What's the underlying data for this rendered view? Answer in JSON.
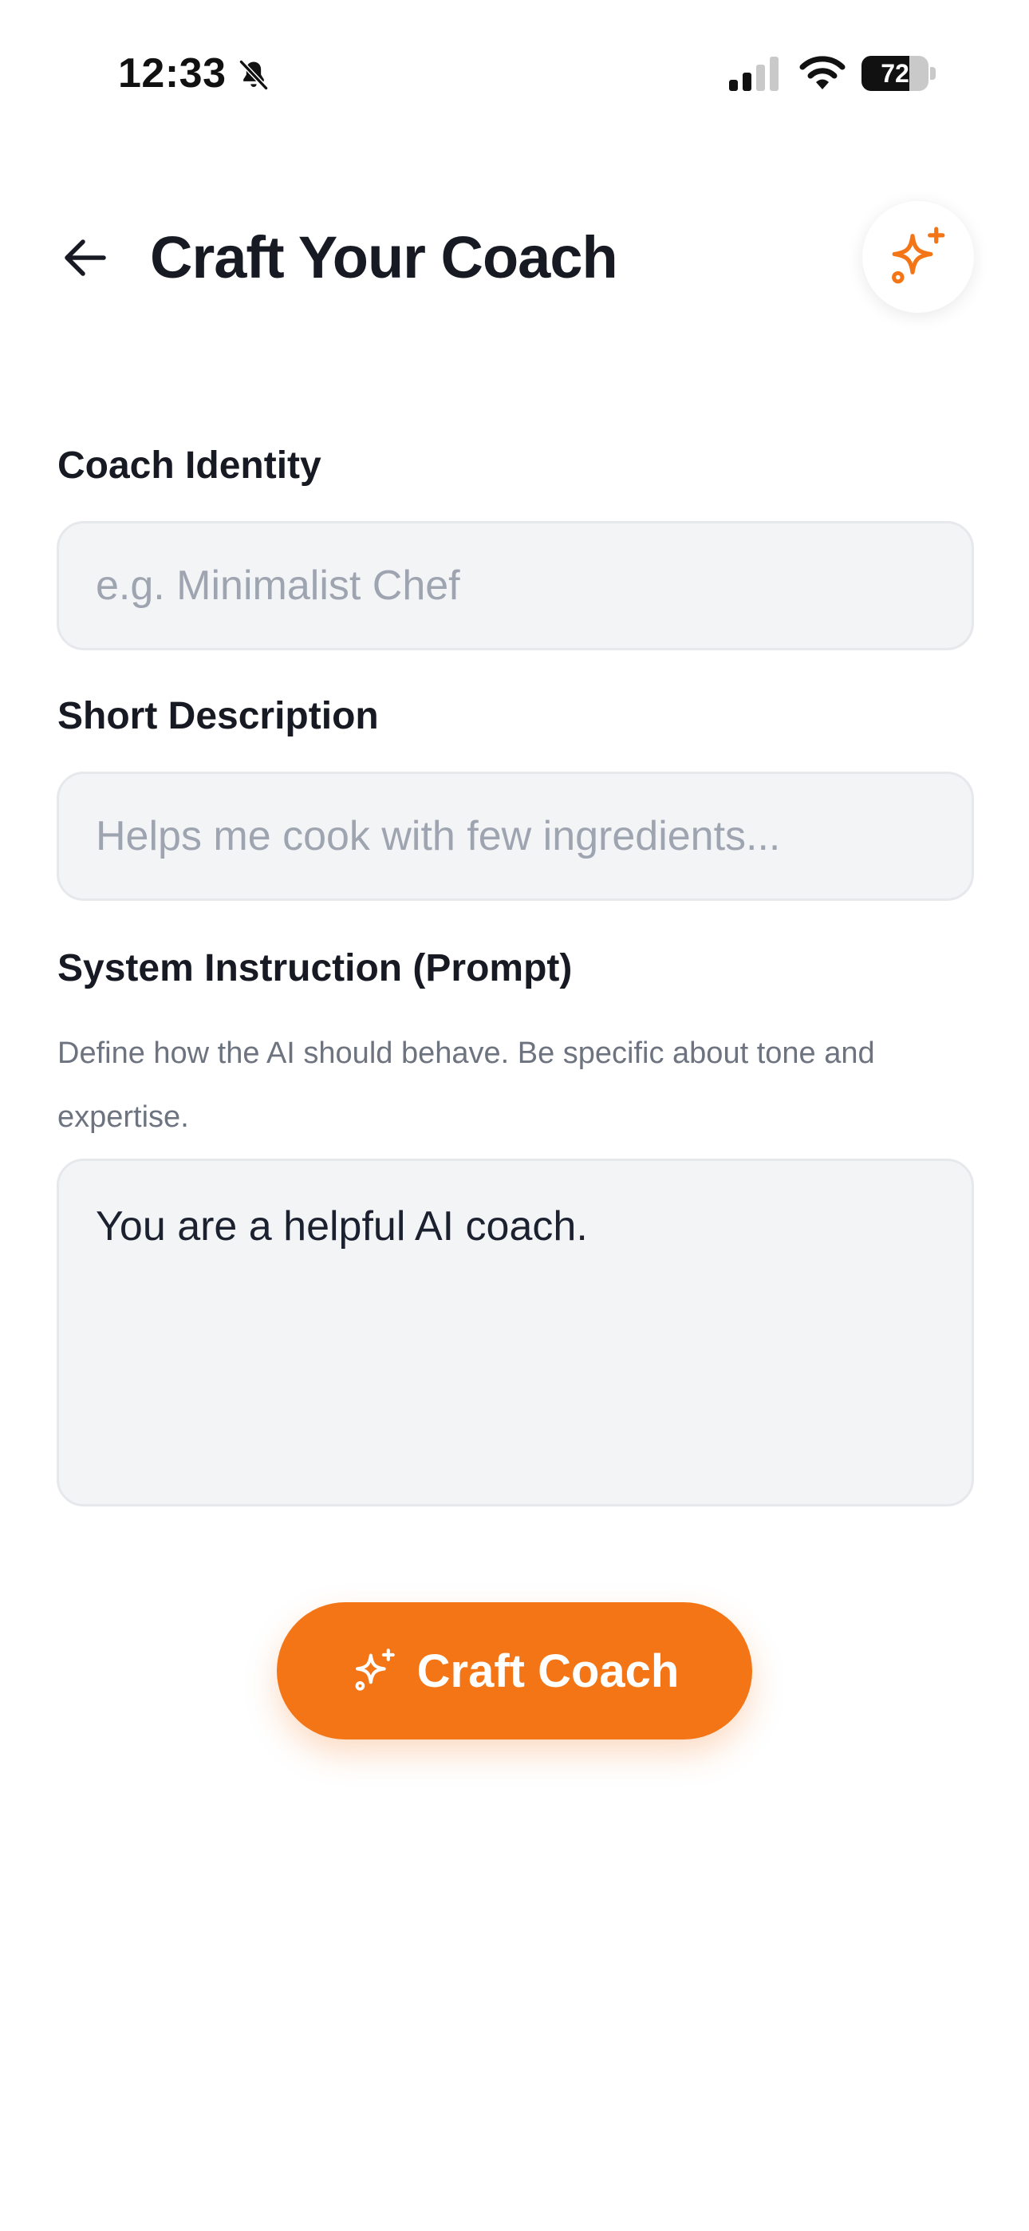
{
  "status_bar": {
    "time": "12:33",
    "battery_level": "72",
    "battery_fraction": 0.72,
    "icons": [
      "bell-slash-icon",
      "cellular-signal-icon",
      "wifi-icon",
      "battery-icon"
    ]
  },
  "header": {
    "title": "Craft Your Coach",
    "back_icon": "arrow-left-icon",
    "action_icon": "sparkles-icon"
  },
  "form": {
    "identity": {
      "label": "Coach Identity",
      "placeholder": "e.g. Minimalist Chef",
      "value": ""
    },
    "description": {
      "label": "Short Description",
      "placeholder": "Helps me cook with few ingredients...",
      "value": ""
    },
    "instruction": {
      "label": "System Instruction (Prompt)",
      "helper": "Define how the AI should behave. Be specific about tone and expertise.",
      "value": "You are a helpful AI coach."
    }
  },
  "cta": {
    "label": "Craft Coach",
    "icon": "sparkles-icon"
  },
  "colors": {
    "accent": "#f47516",
    "input_bg": "#f3f4f6",
    "text_primary": "#171a23",
    "text_muted": "#6d7480"
  }
}
